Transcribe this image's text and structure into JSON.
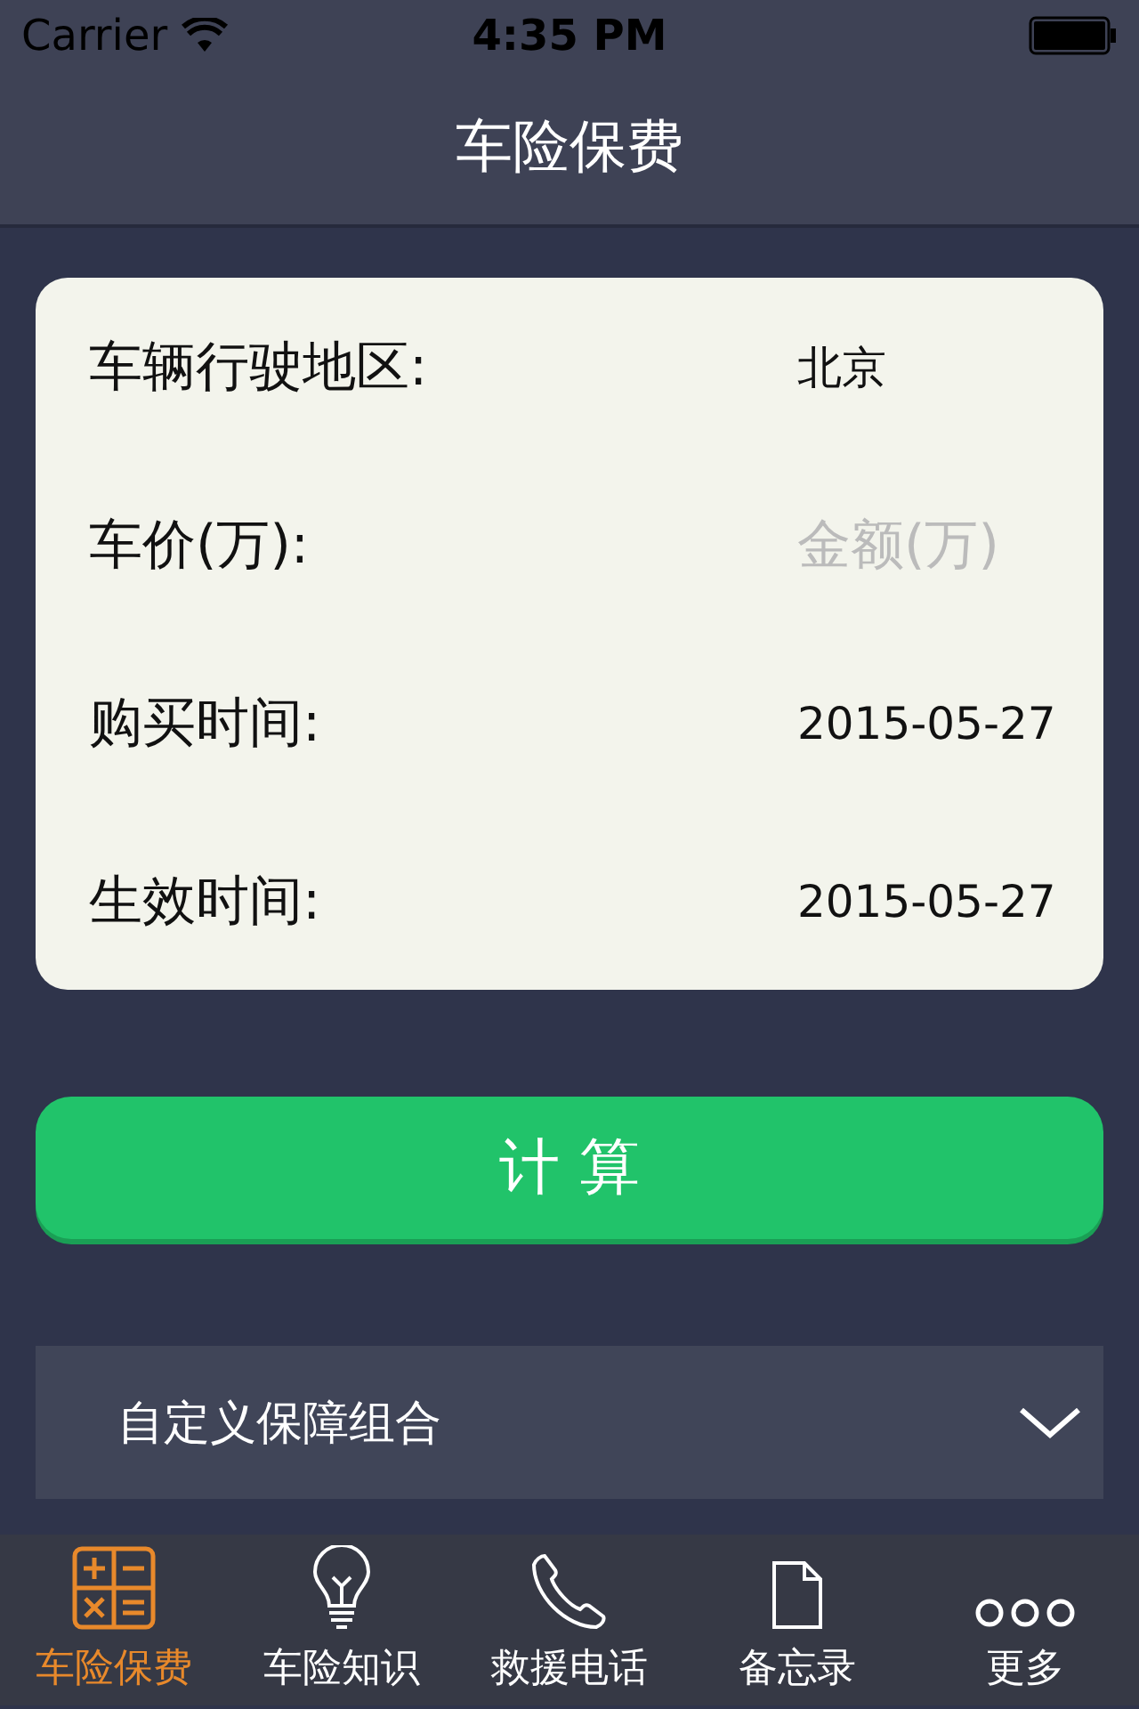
{
  "status_bar": {
    "carrier": "Carrier",
    "time": "4:35 PM"
  },
  "nav": {
    "title": "车险保费"
  },
  "form": [
    {
      "label": "车辆行驶地区:",
      "kind": "value",
      "value": "北京"
    },
    {
      "label": "车价(万):",
      "kind": "input",
      "placeholder": "金额(万)"
    },
    {
      "label": "购买时间:",
      "kind": "value",
      "value": "2015-05-27"
    },
    {
      "label": "生效时间:",
      "kind": "value",
      "value": "2015-05-27"
    }
  ],
  "calculate_button": "计 算",
  "custom_section": {
    "title": "自定义保障组合",
    "expanded": false
  },
  "tabs": [
    {
      "label": "车险保费",
      "kind": "calculator",
      "selected": true
    },
    {
      "label": "车险知识",
      "kind": "bulb",
      "selected": false
    },
    {
      "label": "救援电话",
      "kind": "phone",
      "selected": false
    },
    {
      "label": "备忘录",
      "kind": "document",
      "selected": false
    },
    {
      "label": "更多",
      "kind": "more",
      "selected": false
    }
  ]
}
